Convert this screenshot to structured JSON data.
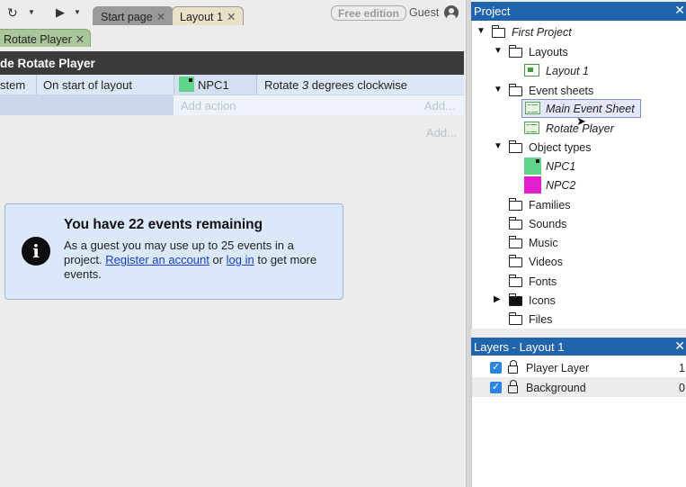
{
  "toolbar": {
    "redo_icon": "redo-icon",
    "play_icon": "play-icon",
    "tabs": [
      {
        "label": "Start page"
      },
      {
        "label": "Layout 1"
      }
    ],
    "edition_badge": "Free edition",
    "user_label": "Guest"
  },
  "sheet_tab": {
    "label": "Rotate Player"
  },
  "event_sheet": {
    "header": "de Rotate Player",
    "event": {
      "object": "stem",
      "condition": "On start of layout",
      "action_object": "NPC1",
      "action_text_pre": "Rotate ",
      "action_text_value": "3",
      "action_text_post": " degrees clockwise"
    },
    "add_action": "Add action",
    "add_short": "Add...",
    "add_event": "Add..."
  },
  "notice": {
    "title": "You have 22 events remaining",
    "line1": "As a guest you may use up to 25 events in a project. ",
    "link1": "Register an account",
    "mid": " or ",
    "link2": "log in",
    "line2": " to get more events."
  },
  "project_panel": {
    "title": "Project",
    "root": "First Project",
    "layouts_folder": "Layouts",
    "layout_1": "Layout 1",
    "event_sheets_folder": "Event sheets",
    "sheet_main": "Main Event Sheet",
    "sheet_rotate": "Rotate Player",
    "object_types_folder": "Object types",
    "object_npc1": "NPC1",
    "object_npc2": "NPC2",
    "families": "Families",
    "sounds": "Sounds",
    "music": "Music",
    "videos": "Videos",
    "fonts": "Fonts",
    "icons": "Icons",
    "files": "Files"
  },
  "layers_panel": {
    "title": "Layers - Layout 1",
    "layers": [
      {
        "name": "Player Layer",
        "index": "1"
      },
      {
        "name": "Background",
        "index": "0"
      }
    ]
  },
  "colors": {
    "panel_header": "#1f64ad",
    "sheet_header": "#3b3b3b",
    "sprite_npc1": "#5fd48a",
    "sprite_npc2": "#e31ecf",
    "link": "#1a3fcf"
  }
}
